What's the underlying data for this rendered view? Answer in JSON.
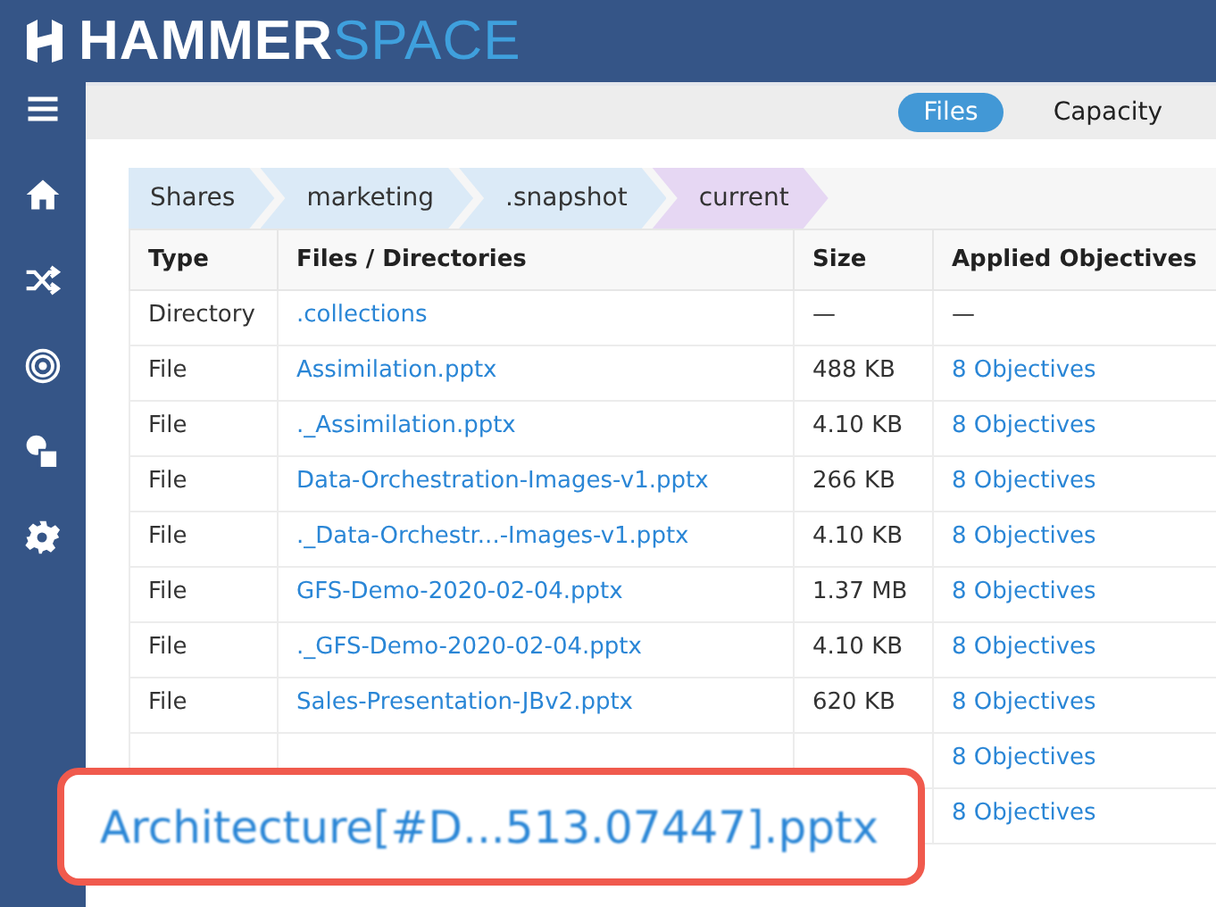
{
  "logo": {
    "bold": "HAMMER",
    "light": "SPACE"
  },
  "sidebar": {
    "items": [
      {
        "kind": "menu"
      },
      {
        "kind": "home"
      },
      {
        "kind": "shuffle"
      },
      {
        "kind": "target"
      },
      {
        "kind": "shapes"
      },
      {
        "kind": "settings"
      }
    ]
  },
  "tabs": [
    {
      "label": "Files",
      "selected": true
    },
    {
      "label": "Capacity",
      "selected": false
    }
  ],
  "breadcrumb": [
    {
      "label": "Shares",
      "selected": false
    },
    {
      "label": "marketing",
      "selected": false
    },
    {
      "label": ".snapshot",
      "selected": false
    },
    {
      "label": "current",
      "selected": true
    }
  ],
  "table": {
    "columns": [
      "Type",
      "Files / Directories",
      "Size",
      "Applied Objectives"
    ],
    "rows": [
      {
        "type": "Directory",
        "name": ".collections",
        "size": "—",
        "objectives": "—",
        "objectives_link": false
      },
      {
        "type": "File",
        "name": "Assimilation.pptx",
        "size": "488 KB",
        "objectives": "8 Objectives",
        "objectives_link": true
      },
      {
        "type": "File",
        "name": "._Assimilation.pptx",
        "size": "4.10 KB",
        "objectives": "8 Objectives",
        "objectives_link": true
      },
      {
        "type": "File",
        "name": "Data-Orchestration-Images-v1.pptx",
        "size": "266 KB",
        "objectives": "8 Objectives",
        "objectives_link": true
      },
      {
        "type": "File",
        "name": "._Data-Orchestr...-Images-v1.pptx",
        "size": "4.10 KB",
        "objectives": "8 Objectives",
        "objectives_link": true
      },
      {
        "type": "File",
        "name": "GFS-Demo-2020-02-04.pptx",
        "size": "1.37 MB",
        "objectives": "8 Objectives",
        "objectives_link": true
      },
      {
        "type": "File",
        "name": "._GFS-Demo-2020-02-04.pptx",
        "size": "4.10 KB",
        "objectives": "8 Objectives",
        "objectives_link": true
      },
      {
        "type": "File",
        "name": "Sales-Presentation-JBv2.pptx",
        "size": "620 KB",
        "objectives": "8 Objectives",
        "objectives_link": true
      },
      {
        "objectives": "8 Objectives",
        "objectives_link": true
      },
      {
        "objectives": "8 Objectives",
        "objectives_link": true
      }
    ]
  },
  "callout": {
    "text": "Architecture[#D...513.07447].pptx"
  }
}
